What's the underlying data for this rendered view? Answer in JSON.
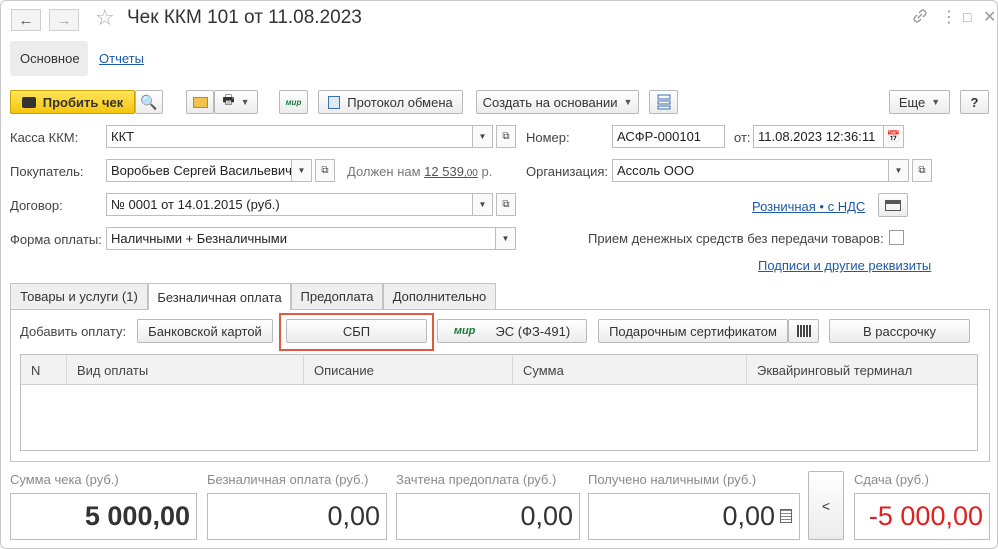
{
  "window": {
    "title": "Чек ККМ 101 от 11.08.2023"
  },
  "section_tabs": {
    "main": "Основное",
    "reports": "Отчеты"
  },
  "toolbar": {
    "print_check": "Пробить чек",
    "mir_logo": "мир",
    "exchange_protocol": "Протокол обмена",
    "create_based_on": "Создать на основании",
    "more": "Еще",
    "help": "?"
  },
  "form": {
    "kassa_label": "Касса ККМ:",
    "kassa_value": "ККТ",
    "number_label": "Номер:",
    "number_value": "АСФР-000101",
    "date_label": "от:",
    "date_value": "11.08.2023 12:36:11",
    "buyer_label": "Покупатель:",
    "buyer_value": "Воробьев Сергей Васильевич",
    "debt_label": "Должен нам",
    "debt_int": "12 539",
    "debt_frac": ",00",
    "debt_currency": "р.",
    "org_label": "Организация:",
    "org_value": "Ассоль ООО",
    "contract_label": "Договор:",
    "contract_value": "№ 0001 от 14.01.2015 (руб.)",
    "retail_link": "Розничная • с НДС",
    "payment_form_label": "Форма оплаты:",
    "payment_form_value": "Наличными + Безналичными",
    "no_goods_label": "Прием денежных средств без передачи товаров:",
    "no_goods_checked": false,
    "signatures_link": "Подписи и другие реквизиты"
  },
  "form_tabs": [
    "Товары и услуги (1)",
    "Безналичная оплата",
    "Предоплата",
    "Дополнительно"
  ],
  "active_tab_index": 1,
  "payment": {
    "add_label": "Добавить оплату:",
    "bank_card": "Банковской картой",
    "sbp": "СБП",
    "mir_logo": "мир",
    "es": "ЭС (ФЗ-491)",
    "gift": "Подарочным сертификатом",
    "installment": "В рассрочку"
  },
  "table": {
    "columns": [
      "N",
      "Вид оплаты",
      "Описание",
      "Сумма",
      "Эквайринговый терминал"
    ],
    "rows": []
  },
  "totals": {
    "check_sum_label": "Сумма чека (руб.)",
    "check_sum": "5 000,00",
    "cashless_label": "Безналичная оплата (руб.)",
    "cashless": "0,00",
    "prepay_label": "Зачтена предоплата (руб.)",
    "prepay": "0,00",
    "cash_label": "Получено наличными (руб.)",
    "cash": "0,00",
    "nav_button": "<",
    "change_label": "Сдача (руб.)",
    "change": "-5 000,00"
  },
  "colors": {
    "link": "#1d5aa6",
    "print_button": "#f5c60e",
    "highlight_border": "#e2583e",
    "negative": "#e0201e",
    "mir_green": "#1a7a3a"
  }
}
